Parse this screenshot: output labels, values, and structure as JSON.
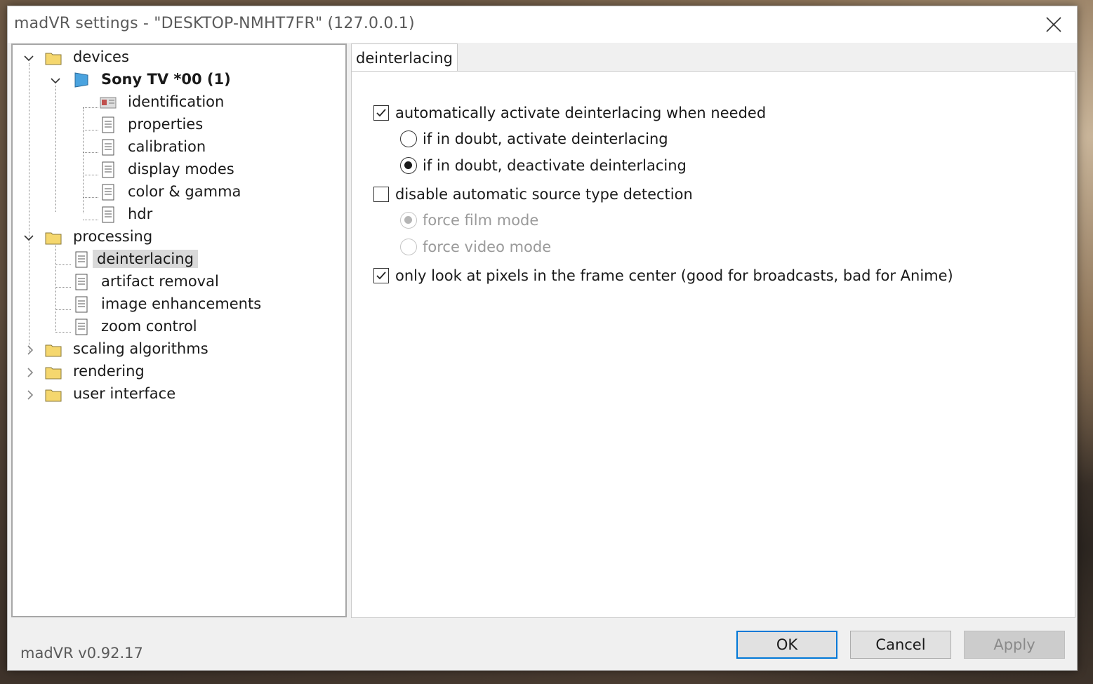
{
  "window": {
    "title": "madVR settings - \"DESKTOP-NMHT7FR\" (127.0.0.1)",
    "close_icon": "close-icon"
  },
  "tree": {
    "devices": {
      "label": "devices",
      "device": {
        "label": "Sony TV *00 (1)",
        "children": [
          "identification",
          "properties",
          "calibration",
          "display modes",
          "color & gamma",
          "hdr"
        ]
      }
    },
    "processing": {
      "label": "processing",
      "children": [
        "deinterlacing",
        "artifact removal",
        "image enhancements",
        "zoom control"
      ],
      "selected": "deinterlacing"
    },
    "collapsed": [
      "scaling algorithms",
      "rendering",
      "user interface"
    ]
  },
  "tab": {
    "label": "deinterlacing"
  },
  "options": {
    "auto_activate": {
      "label": "automatically activate deinterlacing when needed",
      "checked": true
    },
    "doubt_activate": {
      "label": "if in doubt, activate deinterlacing",
      "checked": false
    },
    "doubt_deactivate": {
      "label": "if in doubt, deactivate deinterlacing",
      "checked": true
    },
    "disable_auto_detect": {
      "label": "disable automatic source type detection",
      "checked": false
    },
    "force_film": {
      "label": "force film mode",
      "checked": true,
      "disabled": true
    },
    "force_video": {
      "label": "force video mode",
      "checked": false,
      "disabled": true
    },
    "frame_center": {
      "label": "only look at pixels in the frame center  (good for broadcasts, bad for Anime)",
      "checked": true
    }
  },
  "footer": {
    "version": "madVR v0.92.17",
    "ok_label": "OK",
    "cancel_label": "Cancel",
    "apply_label": "Apply"
  },
  "colors": {
    "selection": "#d9d9d9",
    "default_button_border": "#0078d7",
    "folder": "#f5d76e",
    "monitor": "#4aa3df"
  }
}
